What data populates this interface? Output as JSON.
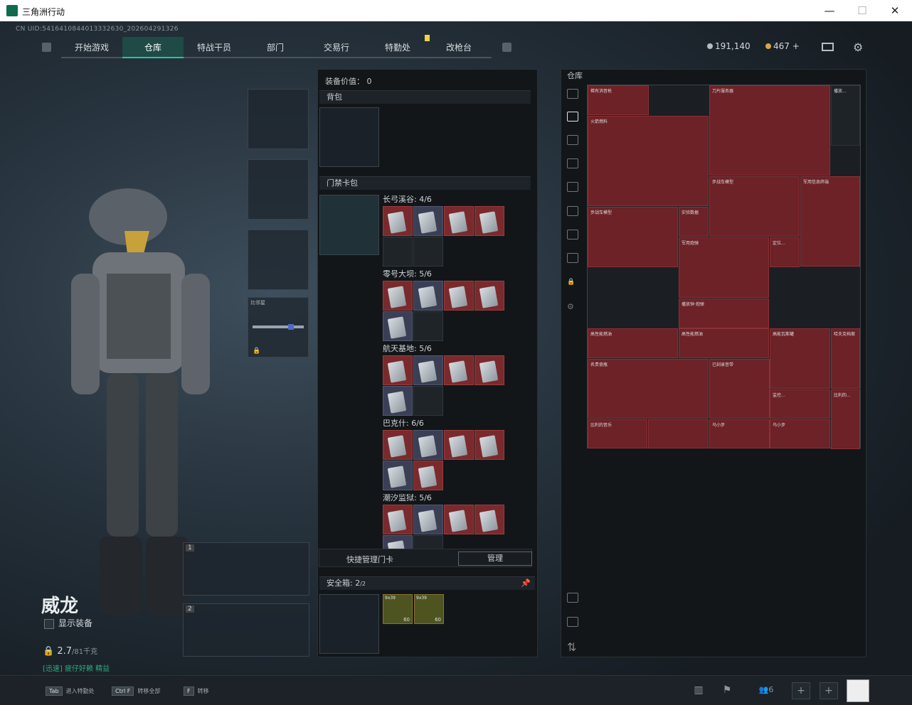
{
  "window": {
    "title": "三角洲行动",
    "controls": [
      "—",
      "☐",
      "✕"
    ]
  },
  "uid": "CN UID:5416410844013332630_202604291326",
  "nav": {
    "tabs": [
      "开始游戏",
      "仓库",
      "特战干员",
      "部门",
      "交易行",
      "特勤处",
      "改枪台"
    ],
    "active": "仓库"
  },
  "currency": {
    "silver": "191,140",
    "gold": "467 +"
  },
  "character": {
    "name": "威龙",
    "show_gear": "显示装备",
    "weight": "2.7",
    "weight_max": "/81千克",
    "status": "[迅速] 疲仔好赖 精益",
    "weapon_slot_label": "比邻星"
  },
  "equipment": {
    "value_label": "装备价值",
    "value": "0",
    "backpack_label": "背包",
    "keycard_label": "门禁卡包",
    "groups": [
      {
        "name": "长弓溪谷: 4/6"
      },
      {
        "name": "零号大坝: 5/6"
      },
      {
        "name": "航天基地: 5/6"
      },
      {
        "name": "巴克什: 6/6"
      },
      {
        "name": "潮汐监狱: 5/6"
      }
    ],
    "quick_manage": "快捷管理门卡",
    "manage_button": "管理",
    "safe_box_label": "安全箱:",
    "safe_box_value": "2",
    "safe_box_sub": "/2",
    "safe_items": [
      {
        "label": "9x39",
        "count": "60"
      },
      {
        "label": "9x39",
        "count": "60"
      }
    ]
  },
  "stash": {
    "title": "仓库",
    "items": [
      "稀有消音枪",
      "刀片服务器",
      "播放...",
      "火箭燃料",
      "步战车模型",
      "军用信息终端",
      "步战车模型",
      "实验数据",
      "军用炮弹",
      "定位...",
      "播放钟·炮弹",
      "高性能燃油",
      "高性能燃油",
      "高能瓦斯罐",
      "哈夫克档案",
      "名贵瓷瓶",
      "已刻录音带",
      "监控...",
      "比利的...",
      "比利的音乐",
      "",
      "乌小步",
      "乌小步"
    ]
  },
  "bottom": {
    "hints": [
      {
        "key": "Tab",
        "text": "进入特勤处"
      },
      {
        "key": "Ctrl F",
        "text": "转移全部"
      },
      {
        "key": "F",
        "text": "转移"
      }
    ],
    "friends": "6"
  },
  "colors": {
    "accent": "#28c49d",
    "item_red": "#7a2a2c",
    "badge": "#f1d24a"
  }
}
